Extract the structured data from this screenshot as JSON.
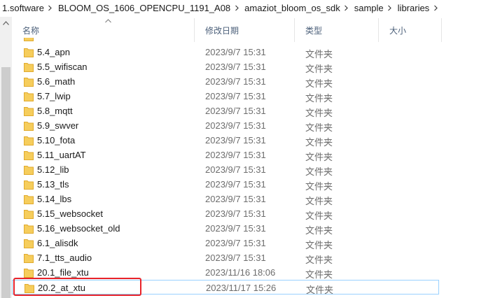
{
  "breadcrumb": [
    "1.software",
    "BLOOM_OS_1606_OPENCPU_1191_A08",
    "amaziot_bloom_os_sdk",
    "sample",
    "libraries"
  ],
  "columns": {
    "name": "名称",
    "date": "修改日期",
    "type": "类型",
    "size": "大小"
  },
  "files": [
    {
      "name": "5.4_apn",
      "date": "2023/9/7 15:31",
      "type": "文件夹"
    },
    {
      "name": "5.5_wifiscan",
      "date": "2023/9/7 15:31",
      "type": "文件夹"
    },
    {
      "name": "5.6_math",
      "date": "2023/9/7 15:31",
      "type": "文件夹"
    },
    {
      "name": "5.7_lwip",
      "date": "2023/9/7 15:31",
      "type": "文件夹"
    },
    {
      "name": "5.8_mqtt",
      "date": "2023/9/7 15:31",
      "type": "文件夹"
    },
    {
      "name": "5.9_swver",
      "date": "2023/9/7 15:31",
      "type": "文件夹"
    },
    {
      "name": "5.10_fota",
      "date": "2023/9/7 15:31",
      "type": "文件夹"
    },
    {
      "name": "5.11_uartAT",
      "date": "2023/9/7 15:31",
      "type": "文件夹"
    },
    {
      "name": "5.12_lib",
      "date": "2023/9/7 15:31",
      "type": "文件夹"
    },
    {
      "name": "5.13_tls",
      "date": "2023/9/7 15:31",
      "type": "文件夹"
    },
    {
      "name": "5.14_lbs",
      "date": "2023/9/7 15:31",
      "type": "文件夹"
    },
    {
      "name": "5.15_websocket",
      "date": "2023/9/7 15:31",
      "type": "文件夹"
    },
    {
      "name": "5.16_websocket_old",
      "date": "2023/9/7 15:31",
      "type": "文件夹"
    },
    {
      "name": "6.1_alisdk",
      "date": "2023/9/7 15:31",
      "type": "文件夹"
    },
    {
      "name": "7.1_tts_audio",
      "date": "2023/9/7 15:31",
      "type": "文件夹"
    },
    {
      "name": "20.1_file_xtu",
      "date": "2023/11/16 18:06",
      "type": "文件夹"
    },
    {
      "name": "20.2_at_xtu",
      "date": "2023/11/17 15:26",
      "type": "文件夹",
      "selected": true
    }
  ],
  "colors": {
    "folder": "#f6cd5c",
    "folder_dark": "#e0aa2e",
    "highlight": "#e8232a",
    "selection_border": "#99d1ff"
  }
}
